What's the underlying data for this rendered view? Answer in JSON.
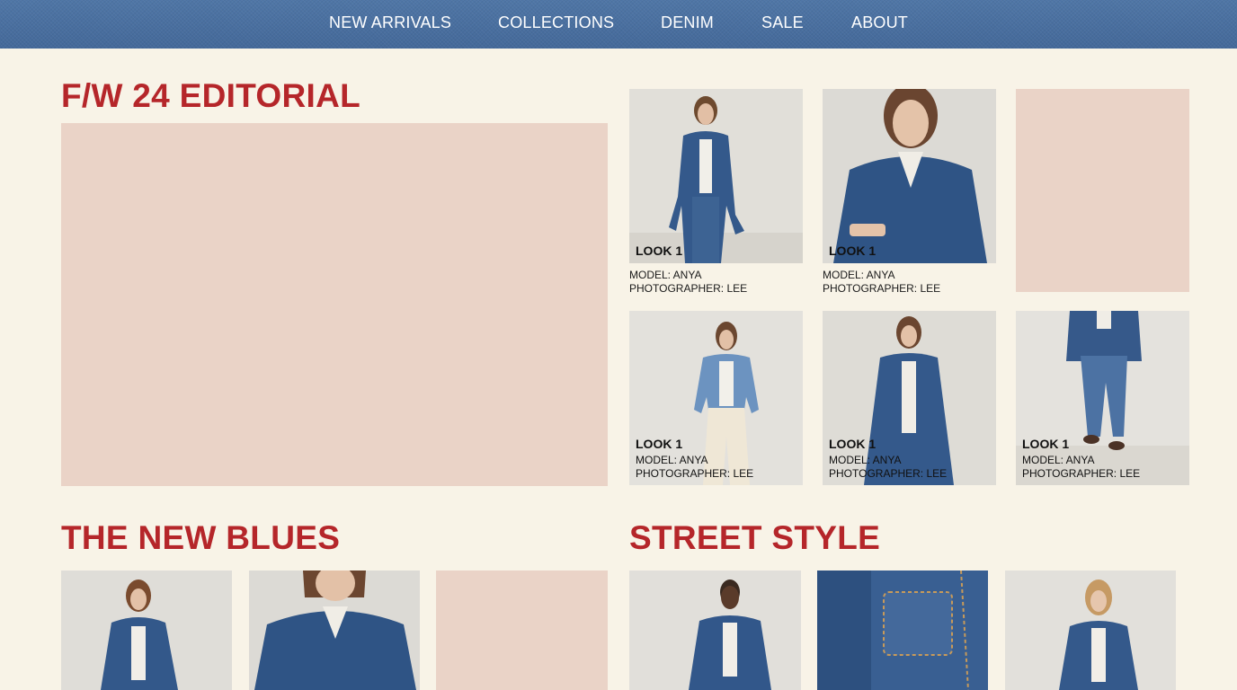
{
  "nav": {
    "items": [
      "NEW ARRIVALS",
      "COLLECTIONS",
      "DENIM",
      "SALE",
      "ABOUT"
    ]
  },
  "editorial": {
    "title": "F/W 24 EDITORIAL",
    "looks": [
      {
        "label": "LOOK 1",
        "model": "MODEL: ANYA",
        "photographer": "PHOTOGRAPHER: LEE"
      },
      {
        "label": "LOOK 1",
        "model": "MODEL: ANYA",
        "photographer": "PHOTOGRAPHER: LEE"
      },
      {
        "label": "LOOK 1",
        "model": "MODEL: ANYA",
        "photographer": "PHOTOGRAPHER: LEE"
      },
      {
        "label": "LOOK 1",
        "model": "MODEL: ANYA",
        "photographer": "PHOTOGRAPHER: LEE"
      },
      {
        "label": "LOOK 1",
        "model": "MODEL: ANYA",
        "photographer": "PHOTOGRAPHER: LEE"
      }
    ]
  },
  "new_blues": {
    "title": "THE NEW BLUES"
  },
  "street_style": {
    "title": "STREET STYLE"
  },
  "colors": {
    "nav_bg": "#48709f",
    "heading": "#b5262a",
    "page_bg": "#f8f3e7",
    "placeholder": "#ead3c7",
    "denim": "#33588a"
  }
}
